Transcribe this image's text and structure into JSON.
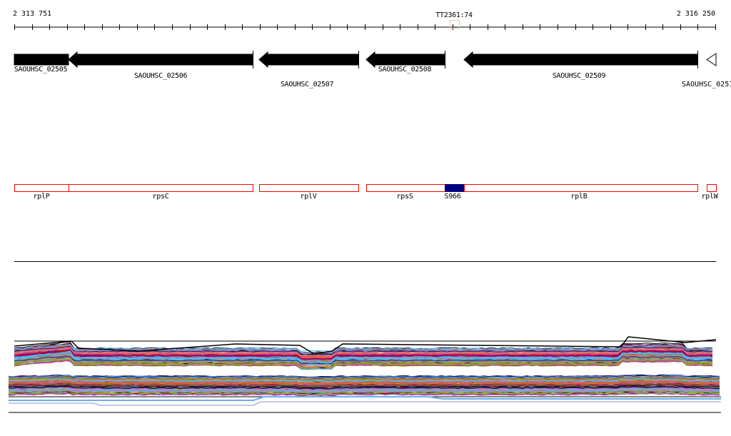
{
  "ruler": {
    "start_label": "2 313 751",
    "end_label": "2 316 250",
    "marker_label": "TT2361:74",
    "marker_color": "#f4c8c0"
  },
  "genes": [
    {
      "name": "SAOUHSC_02505",
      "strand": "-",
      "style": "filled"
    },
    {
      "name": "SAOUHSC_02506",
      "strand": "-",
      "style": "filled"
    },
    {
      "name": "SAOUHSC_02507",
      "strand": "-",
      "style": "filled"
    },
    {
      "name": "SAOUHSC_02508",
      "strand": "-",
      "style": "filled"
    },
    {
      "name": "SAOUHSC_02509",
      "strand": "-",
      "style": "filled"
    },
    {
      "name": "SAOUHSC_0251",
      "strand": "-",
      "style": "outline"
    }
  ],
  "features": [
    {
      "name": "rplP",
      "color": "#ff0000",
      "filled": false
    },
    {
      "name": "rpsC",
      "color": "#ff0000",
      "filled": false
    },
    {
      "name": "rplV",
      "color": "#ff0000",
      "filled": false
    },
    {
      "name": "rpsS",
      "color": "#ff0000",
      "filled": false
    },
    {
      "name": "S966",
      "color": "#000080",
      "filled": true
    },
    {
      "name": "rplB",
      "color": "#ff0000",
      "filled": false
    },
    {
      "name": "rplW",
      "color": "#ff0000",
      "filled": false
    }
  ],
  "profile_colors": [
    "#000000",
    "#8b7a3a",
    "#e8603c",
    "#c040a0",
    "#6aaee8",
    "#7fd000",
    "#a00050",
    "#d07830",
    "#9090d0",
    "#808000",
    "#ff6040",
    "#202060",
    "#c080c0",
    "#40c0ff"
  ]
}
